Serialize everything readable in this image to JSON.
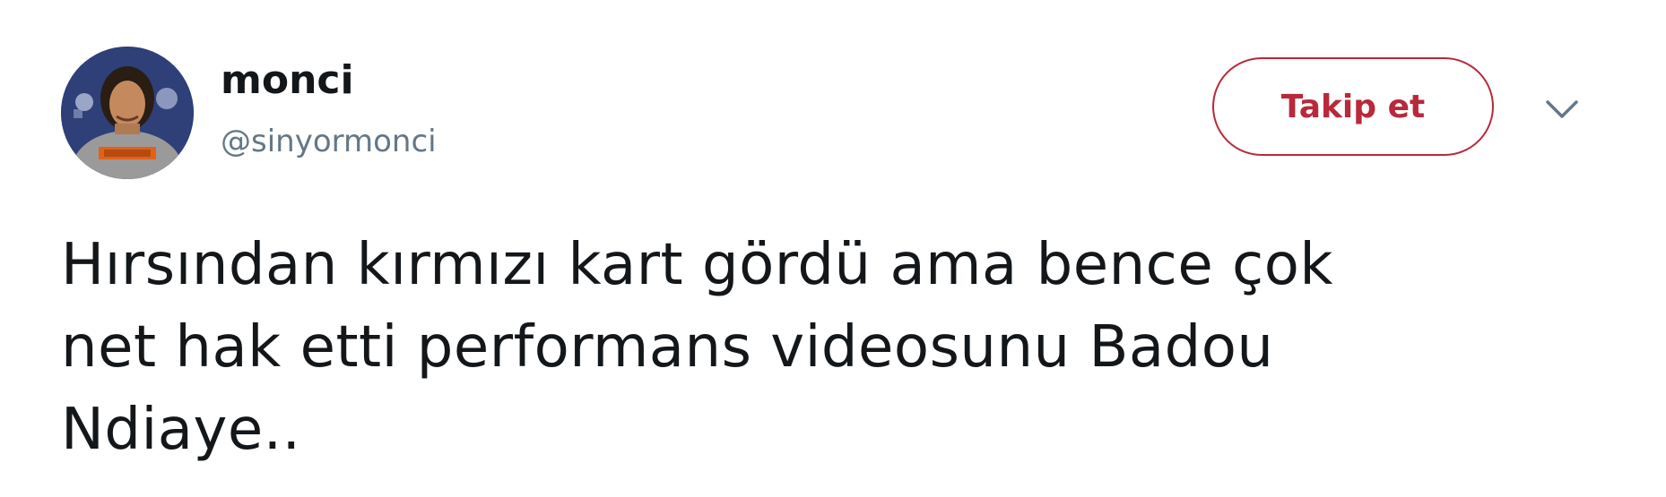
{
  "author": {
    "display_name": "monci",
    "username": "@sinyormonci"
  },
  "actions": {
    "follow_label": "Takip et"
  },
  "tweet": {
    "text": "Hırsından kırmızı kart gördü ama bence çok\nnet hak etti performans videosunu Badou\nNdiaye.."
  },
  "icons": {
    "avatar": "profile-photo",
    "caret": "chevron-down-icon"
  },
  "colors": {
    "accent": "#b8293b",
    "text": "#14171a",
    "secondary_text": "#657786",
    "background": "#ffffff"
  }
}
